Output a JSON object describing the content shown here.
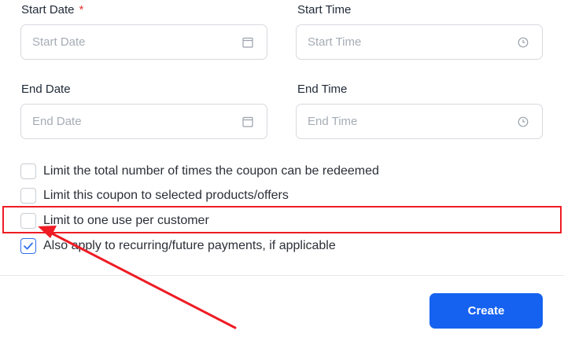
{
  "form": {
    "start_date": {
      "label": "Start Date",
      "required_mark": "*",
      "placeholder": "Start Date",
      "icon": "calendar-icon"
    },
    "start_time": {
      "label": "Start Time",
      "placeholder": "Start Time",
      "icon": "clock-icon"
    },
    "end_date": {
      "label": "End Date",
      "placeholder": "End Date",
      "icon": "calendar-icon"
    },
    "end_time": {
      "label": "End Time",
      "placeholder": "End Time",
      "icon": "clock-icon"
    }
  },
  "options": [
    {
      "label": "Limit the total number of times the coupon can be redeemed",
      "checked": false
    },
    {
      "label": "Limit this coupon to selected products/offers",
      "checked": false
    },
    {
      "label": "Limit to one use per customer",
      "checked": false
    },
    {
      "label": "Also apply to recurring/future payments, if applicable",
      "checked": true
    }
  ],
  "actions": {
    "create_label": "Create"
  },
  "annotation": {
    "color": "#ee1c24"
  },
  "colors": {
    "accent": "#1662f0",
    "checkbox_checked": "#2f6fed"
  }
}
